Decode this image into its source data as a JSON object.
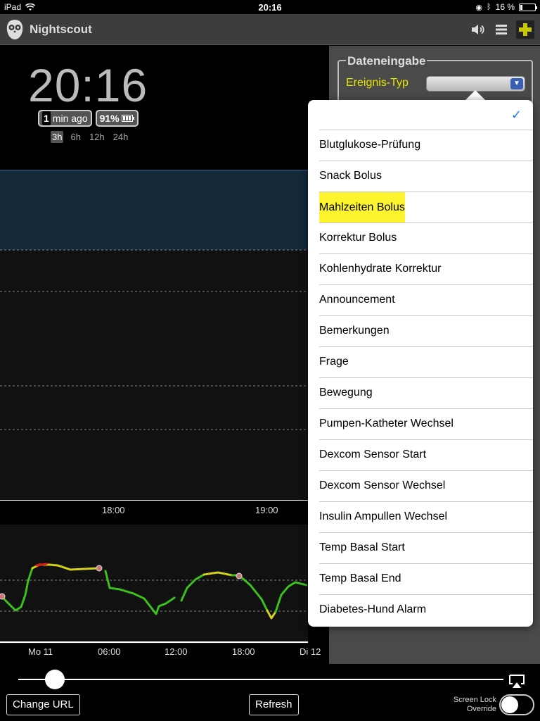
{
  "statusbar": {
    "device": "iPad",
    "time": "20:16",
    "battery": "16 %"
  },
  "header": {
    "title": "Nightscout",
    "icons": [
      "owl-logo-icon",
      "speaker-icon",
      "menu-icon",
      "plus-icon"
    ]
  },
  "clock": "20:16",
  "pills": {
    "ago_num": "1",
    "ago_text": "min ago",
    "uploader": "91%"
  },
  "ranges": {
    "items": [
      "3h",
      "6h",
      "12h",
      "24h"
    ],
    "active": "3h"
  },
  "chart": {
    "xlabels": [
      "18:00",
      "19:00"
    ]
  },
  "focus": {
    "xlabels": [
      "Mo 11",
      "06:00",
      "12:00",
      "18:00",
      "Di 12"
    ]
  },
  "panel": {
    "legend": "Dateneingabe",
    "event_label": "Ereignis-Typ"
  },
  "dropdown": {
    "options": [
      "",
      "Blutglukose-Prüfung",
      "Snack Bolus",
      "Mahlzeiten Bolus",
      "Korrektur Bolus",
      "Kohlenhydrate Korrektur",
      "Announcement",
      "Bemerkungen",
      "Frage",
      "Bewegung",
      "Pumpen-Katheter Wechsel",
      "Dexcom Sensor Start",
      "Dexcom Sensor Wechsel",
      "Insulin Ampullen Wechsel",
      "Temp Basal Start",
      "Temp Basal End",
      "Diabetes-Hund Alarm"
    ],
    "selected_index": 0,
    "highlighted_index": 3
  },
  "bottom": {
    "change_url": "Change URL",
    "refresh": "Refresh",
    "screen_lock": "Screen Lock Override"
  },
  "colors": {
    "accent_yellow": "#e6e600",
    "check_blue": "#157efb",
    "highlight": "#fdf42e"
  }
}
